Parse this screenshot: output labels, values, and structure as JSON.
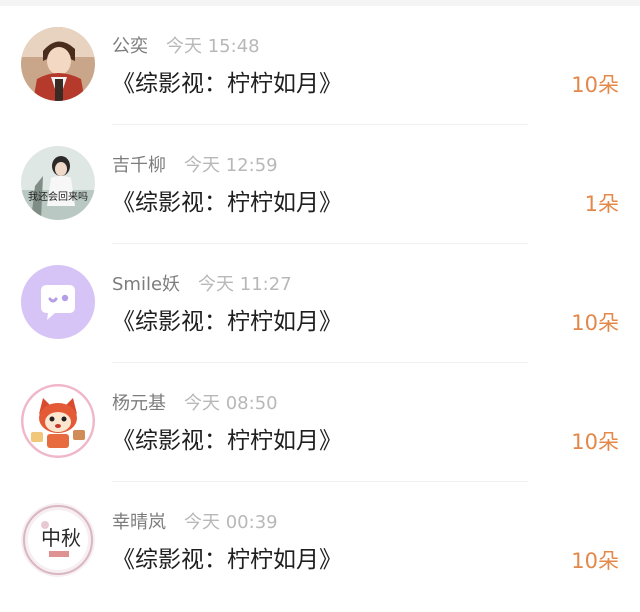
{
  "colors": {
    "accent_orange": "#e4884a",
    "name_gray": "#7d7d7d",
    "time_gray": "#b8b8b8",
    "title_black": "#1f1f1f"
  },
  "gifts": [
    {
      "user": "公奕",
      "time": "今天 15:48",
      "book": "《综影视：柠柠如月》",
      "count": "10朵",
      "avatar": "anime-boy-avatar"
    },
    {
      "user": "吉千柳",
      "time": "今天 12:59",
      "book": "《综影视：柠柠如月》",
      "count": "1朵",
      "avatar": "girl-photo-avatar",
      "avatar_text": "我还会回来吗"
    },
    {
      "user": "Smile妖",
      "time": "今天 11:27",
      "book": "《综影视：柠柠如月》",
      "count": "10朵",
      "avatar": "default-chat-avatar"
    },
    {
      "user": "杨元基",
      "time": "今天 08:50",
      "book": "《综影视：柠柠如月》",
      "count": "10朵",
      "avatar": "cartoon-fox-avatar"
    },
    {
      "user": "幸晴岚",
      "time": "今天 00:39",
      "book": "《综影视：柠柠如月》",
      "count": "10朵",
      "avatar": "mid-autumn-avatar",
      "avatar_text": "中秋"
    }
  ]
}
